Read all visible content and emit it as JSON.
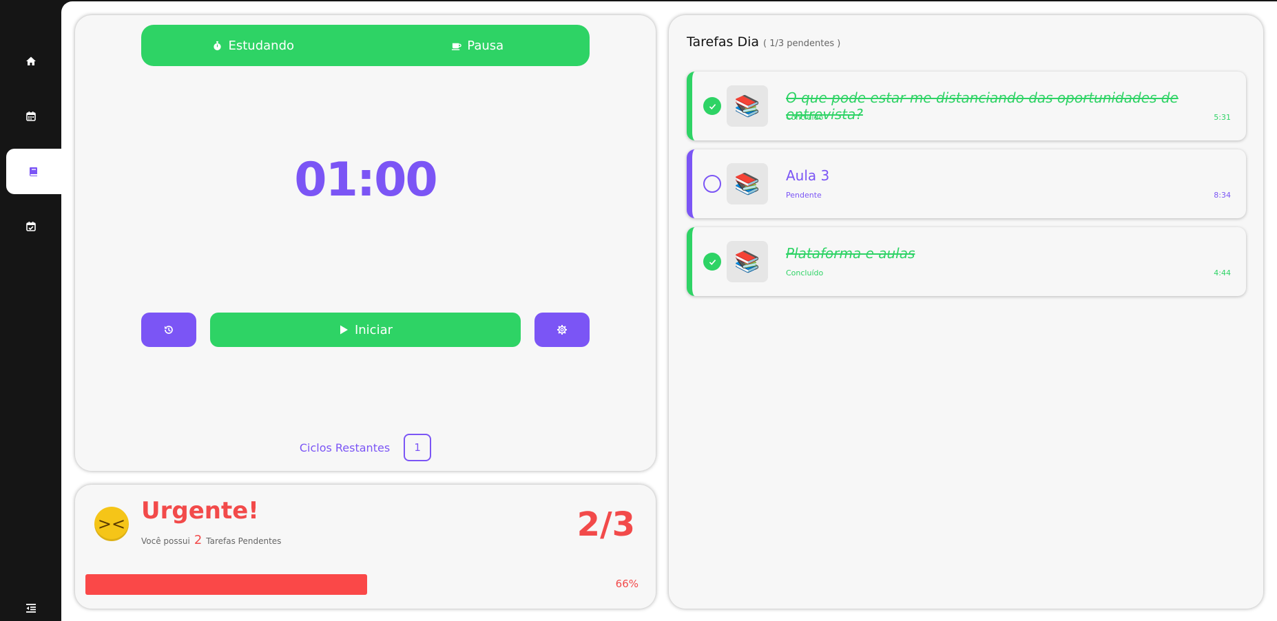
{
  "sidebar": {
    "items": [
      {
        "name": "home",
        "icon": "home-icon"
      },
      {
        "name": "calendar",
        "icon": "calendar-icon"
      },
      {
        "name": "book",
        "icon": "book-icon",
        "active": true
      },
      {
        "name": "tasks",
        "icon": "calendar-check-icon"
      }
    ],
    "bottom_icon": "collapse-menu-icon"
  },
  "timer": {
    "modes": [
      {
        "label": "Estudando",
        "icon": "stopwatch-icon"
      },
      {
        "label": "Pausa",
        "icon": "coffee-icon"
      }
    ],
    "time": "01:00",
    "start_label": "Iniciar",
    "cycles_label": "Ciclos Restantes",
    "cycles_count": "1"
  },
  "urgent": {
    "emoji_icon": "tired-face-icon",
    "title": "Urgente!",
    "sub_prefix": "Você possui",
    "pending_count": "2",
    "sub_suffix": "Tarefas Pendentes",
    "ratio": "2/3",
    "progress": 0.66,
    "progress_label": "66%"
  },
  "tasks": {
    "title": "Tarefas Dia",
    "subtitle": "( 1/3 pendentes )",
    "items": [
      {
        "title": "O que pode estar me distanciando das oportunidades de entrevista?",
        "status": "Concluído",
        "time": "5:31",
        "done": true
      },
      {
        "title": "Aula 3",
        "status": "Pendente",
        "time": "8:34",
        "done": false
      },
      {
        "title": "Plataforma e aulas",
        "status": "Concluído",
        "time": "4:44",
        "done": true
      }
    ]
  },
  "colors": {
    "accent_purple": "#7b55f5",
    "accent_green": "#2ed365",
    "danger_red": "#f24a4a",
    "sidebar_bg": "#151515"
  }
}
